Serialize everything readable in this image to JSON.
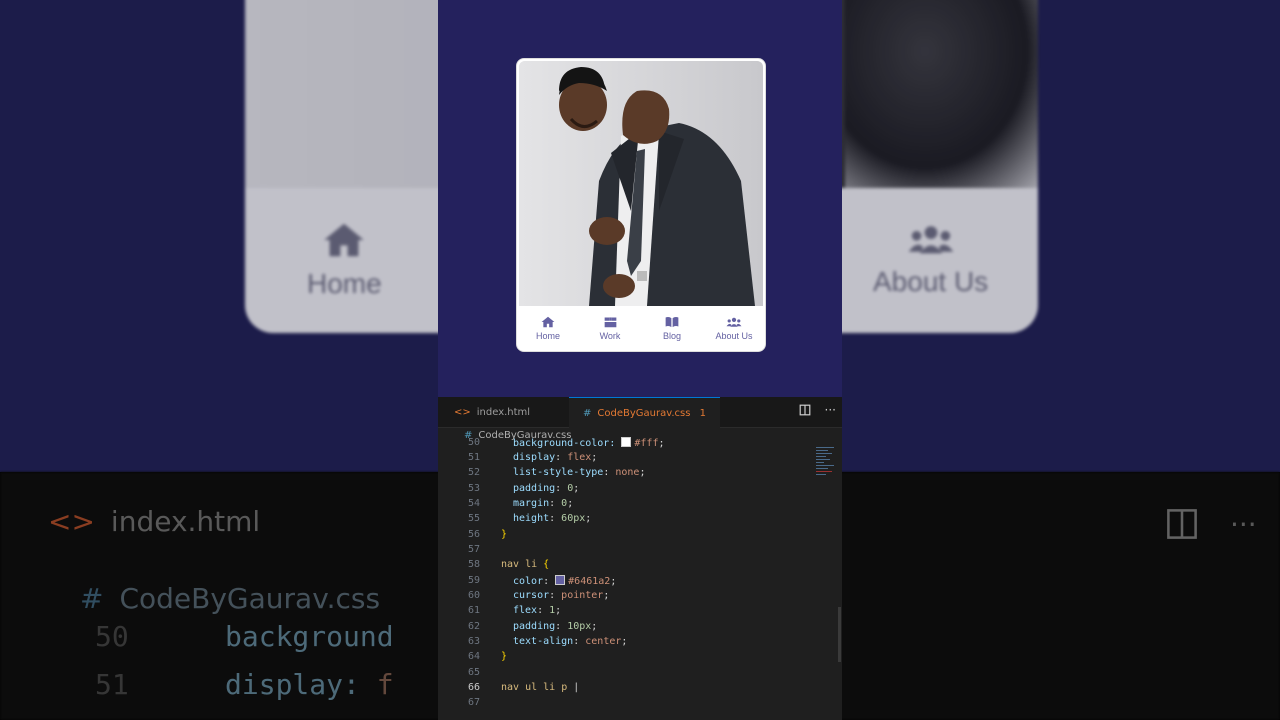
{
  "profile_card": {
    "nav": [
      {
        "label": "Home",
        "icon": "home-icon"
      },
      {
        "label": "Work",
        "icon": "box-icon"
      },
      {
        "label": "Blog",
        "icon": "book-icon"
      },
      {
        "label": "About Us",
        "icon": "users-icon"
      }
    ]
  },
  "background_blur": {
    "nav_left": "Home",
    "nav_right": "About Us",
    "tab_label": "index.html",
    "file_label": "CodeByGaurav.css",
    "code": [
      {
        "num": "50",
        "prop": "background",
        "val": ""
      },
      {
        "num": "51",
        "prop": "display: ",
        "val": "f"
      }
    ]
  },
  "editor": {
    "tabs": [
      {
        "label": "index.html",
        "icon": "html-icon",
        "active": false
      },
      {
        "label": "CodeByGaurav.css",
        "icon": "css-icon",
        "active": true,
        "badge": "1"
      }
    ],
    "breadcrumb": "CodeByGaurav.css",
    "lines": [
      {
        "n": "50",
        "text": "background-color:",
        "color": "#fff"
      },
      {
        "n": "51",
        "text": "display: flex;"
      },
      {
        "n": "52",
        "text": "list-style-type: none;"
      },
      {
        "n": "53",
        "text": "padding: 0;"
      },
      {
        "n": "54",
        "text": "margin: 0;"
      },
      {
        "n": "55",
        "text": "height: 60px;"
      },
      {
        "n": "56",
        "text": "}"
      },
      {
        "n": "57",
        "text": ""
      },
      {
        "n": "58",
        "text": "nav li {"
      },
      {
        "n": "59",
        "text": "color:",
        "color": "#6461a2"
      },
      {
        "n": "60",
        "text": "cursor: pointer;"
      },
      {
        "n": "61",
        "text": "flex: 1;"
      },
      {
        "n": "62",
        "text": "padding: 10px;"
      },
      {
        "n": "63",
        "text": "text-align: center;"
      },
      {
        "n": "64",
        "text": "}"
      },
      {
        "n": "65",
        "text": ""
      },
      {
        "n": "66",
        "text": "nav ul li p"
      },
      {
        "n": "67",
        "text": ""
      }
    ]
  },
  "colors": {
    "page_bg": "#24215d",
    "nav_text": "#6461a2",
    "editor_bg": "#1f1f1f",
    "active_tab_text": "#e37933"
  }
}
